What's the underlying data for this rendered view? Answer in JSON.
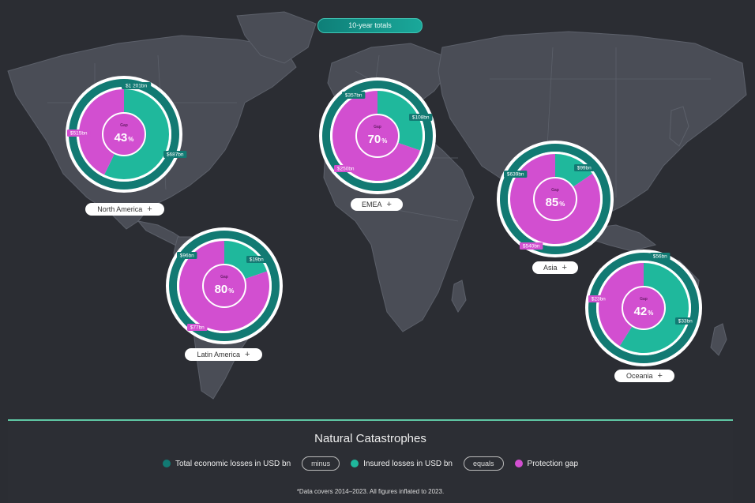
{
  "header": {
    "pill_label": "10-year totals"
  },
  "colors": {
    "total": "#127a73",
    "insured": "#1fb89c",
    "gap": "#d24fd0",
    "ring_border": "#ffffff"
  },
  "chart_data": {
    "type": "pie",
    "title": "Natural Catastrophes",
    "regions": [
      {
        "name": "North America",
        "total_label": "$1 201bn",
        "insured_label": "$687bn",
        "gap_label": "$515bn",
        "total": 1201,
        "insured": 687,
        "gap": 515,
        "gap_word": "Gap",
        "gap_percent": "43",
        "gap_percent_suffix": "%"
      },
      {
        "name": "EMEA",
        "total_label": "$357bn",
        "insured_label": "$108bn",
        "gap_label": "$250bn",
        "total": 357,
        "insured": 108,
        "gap": 250,
        "gap_word": "Gap",
        "gap_percent": "70",
        "gap_percent_suffix": "%"
      },
      {
        "name": "Asia",
        "total_label": "$639bn",
        "insured_label": "$99bn",
        "gap_label": "$540bn",
        "total": 639,
        "insured": 99,
        "gap": 540,
        "gap_word": "Gap",
        "gap_percent": "85",
        "gap_percent_suffix": "%"
      },
      {
        "name": "Latin America",
        "total_label": "$96bn",
        "insured_label": "$19bn",
        "gap_label": "$77bn",
        "total": 96,
        "insured": 19,
        "gap": 77,
        "gap_word": "Gap",
        "gap_percent": "80",
        "gap_percent_suffix": "%"
      },
      {
        "name": "Oceania",
        "total_label": "$56bn",
        "insured_label": "$33bn",
        "gap_label": "$23bn",
        "total": 56,
        "insured": 33,
        "gap": 23,
        "gap_word": "Gap",
        "gap_percent": "42",
        "gap_percent_suffix": "%"
      }
    ]
  },
  "legend": {
    "title": "Natural Catastrophes",
    "items": {
      "total": "Total economic losses in USD bn",
      "minus": "minus",
      "insured": "Insured losses in USD bn",
      "equals": "equals",
      "gap": "Protection gap"
    },
    "footnote": "*Data covers 2014–2023. All figures inflated to 2023."
  },
  "region_buttons": {
    "plus_symbol": "+"
  }
}
